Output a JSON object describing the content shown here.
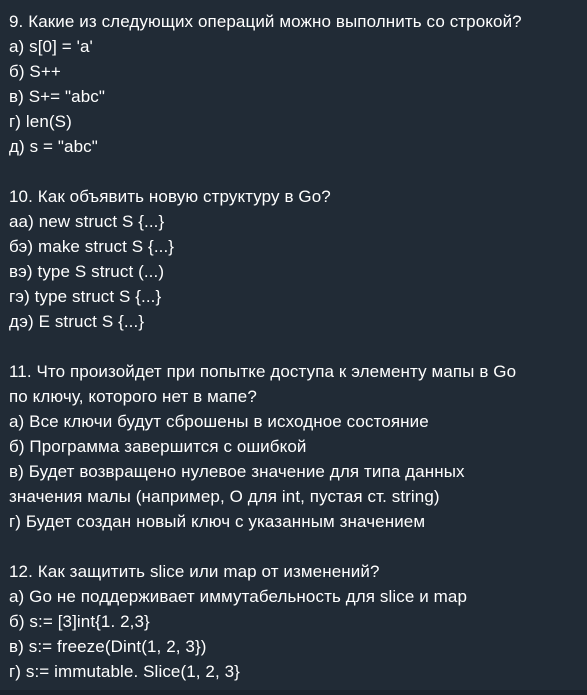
{
  "questions": [
    {
      "lines": [
        "9. Какие из следующих операций можно выполнить со строкой?",
        "а) s[0] = 'a'",
        "б) S++",
        "в) S+= \"abc\"",
        "г) len(S)",
        "д) s = \"abc\""
      ]
    },
    {
      "lines": [
        "10. Как объявить новую структуру в Go?",
        "аа) new struct S {...}",
        "бэ) make struct S {...}",
        "вэ) type S struct (...)",
        "гэ) type struct S {...}",
        "дэ) E struct S {...}"
      ]
    },
    {
      "lines": [
        "11. Что произойдет при попытке доступа к элементу мапы в Go",
        "по ключу, которого нет в мапе?",
        "а) Все ключи будут сброшены в исходное состояние",
        "б) Программа завершится с ошибкой",
        "в) Будет возвращено нулевое значение для типа данных",
        "значения малы (например, О для int, пустая ст. string)",
        "г) Будет создан новый ключ с указанным значением"
      ]
    },
    {
      "lines": [
        "12. Как защитить slice или map от изменений?",
        "а) Go не поддерживает иммутабельность для slice и map",
        "б) s:= [3]int{1. 2,3}",
        "в) s:= freeze(Dint(1, 2, 3})",
        "г) s:= immutable. Slice(1, 2, 3}"
      ]
    }
  ]
}
